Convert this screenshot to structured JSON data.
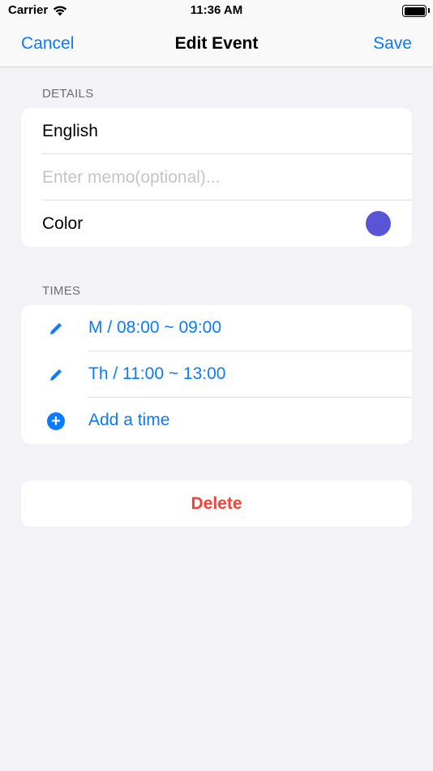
{
  "status_bar": {
    "carrier": "Carrier",
    "time": "11:36 AM"
  },
  "nav": {
    "cancel_label": "Cancel",
    "title": "Edit Event",
    "save_label": "Save"
  },
  "details": {
    "header": "DETAILS",
    "name_value": "English",
    "memo_placeholder": "Enter memo(optional)...",
    "color_label": "Color",
    "color_value": "#5856d6"
  },
  "times": {
    "header": "TIMES",
    "entries": [
      {
        "label": "M / 08:00 ~ 09:00",
        "icon": "pencil-icon"
      },
      {
        "label": "Th / 11:00 ~ 13:00",
        "icon": "pencil-icon"
      }
    ],
    "add_label": "Add a time",
    "add_icon": "plus-circle-icon"
  },
  "delete": {
    "label": "Delete"
  },
  "colors": {
    "accent": "#0a7aff",
    "destructive": "#f2433a",
    "background": "#f2f2f7"
  }
}
